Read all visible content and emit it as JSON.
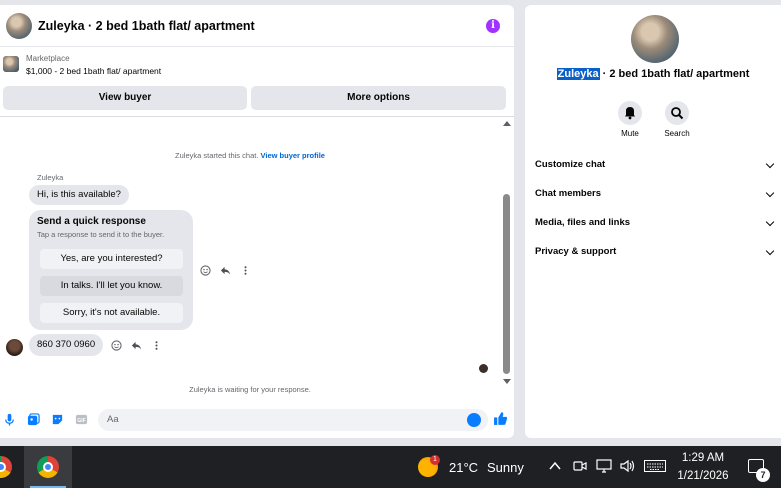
{
  "header": {
    "title": "Zuleyka · 2 bed 1bath flat/ apartment"
  },
  "listing": {
    "label": "Marketplace",
    "price_title": "$1,000 - 2 bed 1bath flat/ apartment",
    "view_buyer": "View buyer",
    "more_options": "More options"
  },
  "messages": {
    "started_text": "Zuleyka started this chat.",
    "view_profile_link": "View buyer profile",
    "sender_name": "Zuleyka",
    "first_message": "Hi, is this available?",
    "quick_response": {
      "title": "Send a quick response",
      "subtitle": "Tap a response to send it to the buyer.",
      "options": [
        "Yes, are you interested?",
        "In talks. I'll let you know.",
        "Sorry, it's not available."
      ]
    },
    "my_message": "860 370 0960",
    "waiting_text": "Zuleyka is waiting for your response."
  },
  "composer": {
    "placeholder": "Aa"
  },
  "info_panel": {
    "name_highlighted": "Zuleyka",
    "title_rest": " · 2 bed 1bath flat/ apartment",
    "mute_label": "Mute",
    "search_label": "Search",
    "sections": [
      "Customize chat",
      "Chat members",
      "Media, files and links",
      "Privacy & support"
    ]
  },
  "taskbar": {
    "temperature": "21°C",
    "condition": "Sunny",
    "weather_badge": "1",
    "time": "1:29 AM",
    "date": "1/21/2026",
    "notification_count": "7"
  },
  "colors": {
    "accent": "#0a7cff",
    "info_icon": "#a033ff",
    "selection": "#0a60c9"
  }
}
